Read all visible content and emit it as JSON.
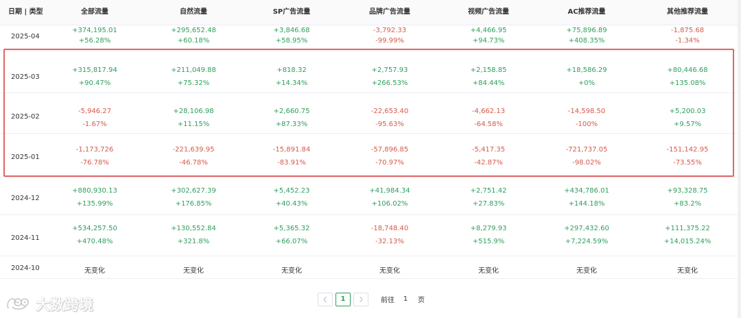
{
  "header": {
    "date_col": "日期 | 类型",
    "columns": [
      "全部流量",
      "自然流量",
      "SP广告流量",
      "品牌广告流量",
      "视频广告流量",
      "AC推荐流量",
      "其他推荐流量"
    ]
  },
  "rows": [
    {
      "date": "2025-04",
      "cells": [
        {
          "v1": "+374,195.01",
          "v2": "+56.28%",
          "tone": "pos"
        },
        {
          "v1": "+295,652.48",
          "v2": "+60.18%",
          "tone": "pos"
        },
        {
          "v1": "+3,846.68",
          "v2": "+58.95%",
          "tone": "pos"
        },
        {
          "v1": "-3,792.33",
          "v2": "-99.99%",
          "tone": "neg"
        },
        {
          "v1": "+4,466.95",
          "v2": "+94.73%",
          "tone": "pos"
        },
        {
          "v1": "+75,896.89",
          "v2": "+408.35%",
          "tone": "pos"
        },
        {
          "v1": "-1,875.68",
          "v2": "-1.34%",
          "tone": "neg"
        }
      ]
    },
    {
      "date": "2025-03",
      "cells": [
        {
          "v1": "+315,817.94",
          "v2": "+90.47%",
          "tone": "pos"
        },
        {
          "v1": "+211,049.88",
          "v2": "+75.32%",
          "tone": "pos"
        },
        {
          "v1": "+818.32",
          "v2": "+14.34%",
          "tone": "pos"
        },
        {
          "v1": "+2,757.93",
          "v2": "+266.53%",
          "tone": "pos"
        },
        {
          "v1": "+2,158.85",
          "v2": "+84.44%",
          "tone": "pos"
        },
        {
          "v1": "+18,586.29",
          "v2": "+0%",
          "tone": "pos"
        },
        {
          "v1": "+80,446.68",
          "v2": "+135.08%",
          "tone": "pos"
        }
      ]
    },
    {
      "date": "2025-02",
      "cells": [
        {
          "v1": "-5,946.27",
          "v2": "-1.67%",
          "tone": "neg"
        },
        {
          "v1": "+28,106.98",
          "v2": "+11.15%",
          "tone": "pos"
        },
        {
          "v1": "+2,660.75",
          "v2": "+87.33%",
          "tone": "pos"
        },
        {
          "v1": "-22,653.40",
          "v2": "-95.63%",
          "tone": "neg"
        },
        {
          "v1": "-4,662.13",
          "v2": "-64.58%",
          "tone": "neg"
        },
        {
          "v1": "-14,598.50",
          "v2": "-100%",
          "tone": "neg"
        },
        {
          "v1": "+5,200.03",
          "v2": "+9.57%",
          "tone": "pos"
        }
      ]
    },
    {
      "date": "2025-01",
      "cells": [
        {
          "v1": "-1,173,726",
          "v2": "-76.78%",
          "tone": "neg"
        },
        {
          "v1": "-221,639.95",
          "v2": "-46.78%",
          "tone": "neg"
        },
        {
          "v1": "-15,891.84",
          "v2": "-83.91%",
          "tone": "neg"
        },
        {
          "v1": "-57,896.85",
          "v2": "-70.97%",
          "tone": "neg"
        },
        {
          "v1": "-5,417.35",
          "v2": "-42.87%",
          "tone": "neg"
        },
        {
          "v1": "-721,737.05",
          "v2": "-98.02%",
          "tone": "neg"
        },
        {
          "v1": "-151,142.95",
          "v2": "-73.55%",
          "tone": "neg"
        }
      ]
    },
    {
      "date": "2024-12",
      "cells": [
        {
          "v1": "+880,930.13",
          "v2": "+135.99%",
          "tone": "pos"
        },
        {
          "v1": "+302,627.39",
          "v2": "+176.85%",
          "tone": "pos"
        },
        {
          "v1": "+5,452.23",
          "v2": "+40.43%",
          "tone": "pos"
        },
        {
          "v1": "+41,984.34",
          "v2": "+106.02%",
          "tone": "pos"
        },
        {
          "v1": "+2,751.42",
          "v2": "+27.83%",
          "tone": "pos"
        },
        {
          "v1": "+434,786.01",
          "v2": "+144.18%",
          "tone": "pos"
        },
        {
          "v1": "+93,328.75",
          "v2": "+83.2%",
          "tone": "pos"
        }
      ]
    },
    {
      "date": "2024-11",
      "cells": [
        {
          "v1": "+534,257.50",
          "v2": "+470.48%",
          "tone": "pos"
        },
        {
          "v1": "+130,552.84",
          "v2": "+321.8%",
          "tone": "pos"
        },
        {
          "v1": "+5,365.32",
          "v2": "+66.07%",
          "tone": "pos"
        },
        {
          "v1": "-18,748.40",
          "v2": "-32.13%",
          "tone": "neg"
        },
        {
          "v1": "+8,279.93",
          "v2": "+515.9%",
          "tone": "pos"
        },
        {
          "v1": "+297,432.60",
          "v2": "+7,224.59%",
          "tone": "pos"
        },
        {
          "v1": "+111,375.22",
          "v2": "+14,015.24%",
          "tone": "pos"
        }
      ]
    },
    {
      "date": "2024-10",
      "cells": [
        {
          "v1": "无变化",
          "v2": "",
          "tone": "neu"
        },
        {
          "v1": "无变化",
          "v2": "",
          "tone": "neu"
        },
        {
          "v1": "无变化",
          "v2": "",
          "tone": "neu"
        },
        {
          "v1": "无变化",
          "v2": "",
          "tone": "neu"
        },
        {
          "v1": "无变化",
          "v2": "",
          "tone": "neu"
        },
        {
          "v1": "无变化",
          "v2": "",
          "tone": "neu"
        },
        {
          "v1": "无变化",
          "v2": "",
          "tone": "neu"
        }
      ]
    }
  ],
  "pagination": {
    "prev_icon": "chevron-left-icon",
    "current_page": "1",
    "next_icon": "chevron-right-icon",
    "goto_label": "前往",
    "goto_value": "1",
    "page_suffix": "页"
  },
  "watermark": {
    "text": "大数跨境",
    "icon": "logo-icon"
  },
  "colors": {
    "positive": "#2e9e5b",
    "negative": "#d45a4a",
    "highlight": "#e06464"
  }
}
